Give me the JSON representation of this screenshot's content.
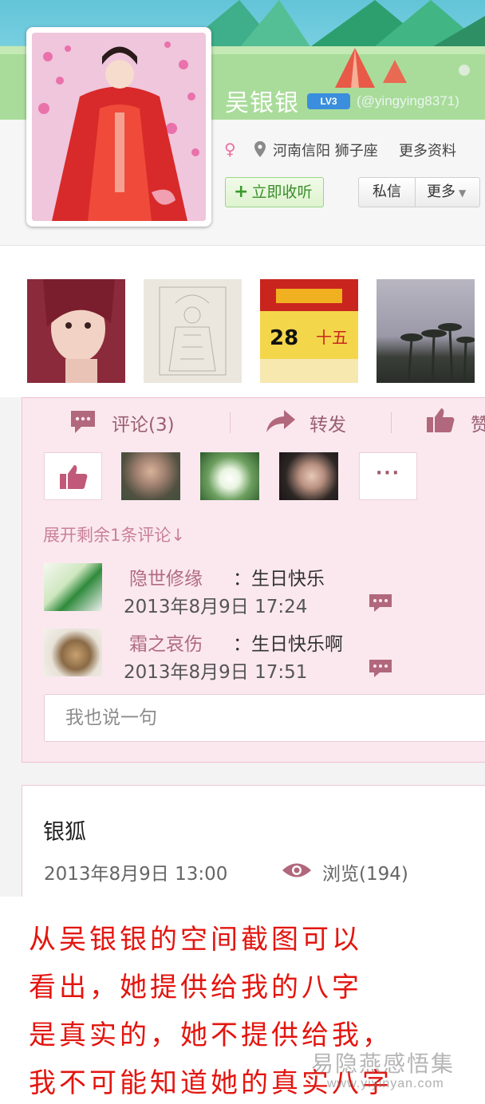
{
  "profile": {
    "name": "吴银银",
    "level_badge": "LV3",
    "handle": "(@yingying8371)",
    "gender_symbol": "♀",
    "location": "河南信阳 狮子座",
    "more_info": "更多资料",
    "follow_label": "立即收听",
    "message_label": "私信",
    "more_label": "更多"
  },
  "feed": {
    "comment_label": "评论(3)",
    "repost_label": "转发",
    "like_label_partial": "赞",
    "expand_label": "展开剩余1条评论↓",
    "comments": [
      {
        "author": "隐世修缘",
        "text": "：生日快乐",
        "time": "2013年8月9日 17:24"
      },
      {
        "author": "霜之哀伤",
        "text": "：生日快乐啊",
        "time": "2013年8月9日 17:51"
      }
    ],
    "input_placeholder": "我也说一句"
  },
  "post": {
    "title": "银狐",
    "time": "2013年8月9日 13:00",
    "views": "浏览(194)"
  },
  "note": {
    "lines": [
      "从吴银银的空间截图可以",
      "看出，她提供给我的八字",
      "是真实的，她不提供给我，",
      "我不可能知道她的真实八字"
    ]
  },
  "watermark": {
    "text": "易隐燕感悟集",
    "url": "www.yiyinyan.com"
  },
  "colors": {
    "banner_sky": "#76cfe0",
    "banner_grass": "#b3dfa2",
    "card_pink": "#fbe8ef",
    "accent_pink": "#b06a80",
    "note_red": "#e3150f",
    "follow_green": "#3a8f2a"
  }
}
